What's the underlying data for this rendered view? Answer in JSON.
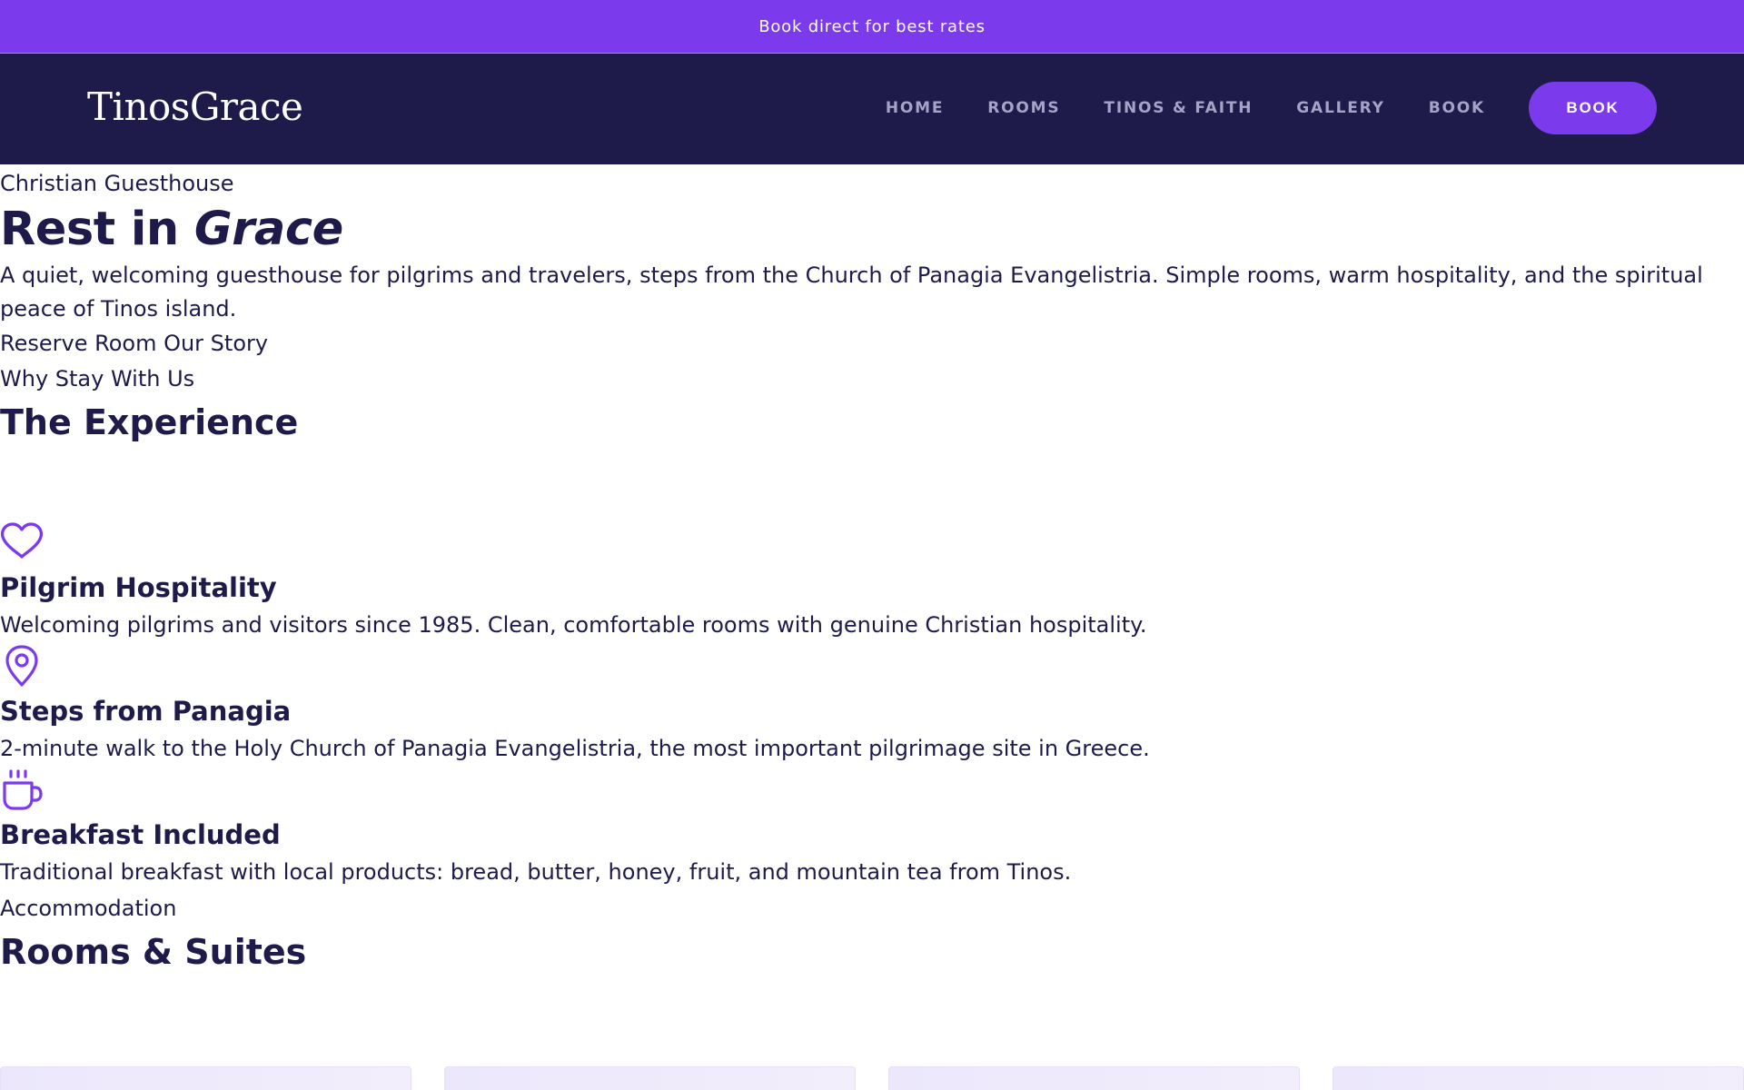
{
  "announcement": {
    "text": "Book direct for best rates"
  },
  "header": {
    "logo": "TinosGrace",
    "nav": [
      {
        "label": "HOME"
      },
      {
        "label": "ROOMS"
      },
      {
        "label": "TINOS & FAITH"
      },
      {
        "label": "GALLERY"
      },
      {
        "label": "BOOK"
      }
    ],
    "cta_label": "BOOK"
  },
  "hero": {
    "eyebrow": "Christian Guesthouse",
    "title_plain": "Rest in ",
    "title_emphasis": "Grace",
    "description": "A quiet, welcoming guesthouse for pilgrims and travelers, steps from the Church of Panagia Evangelistria. Simple rooms, warm hospitality, and the spiritual peace of Tinos island.",
    "actions": "Reserve Room Our Story"
  },
  "experience": {
    "eyebrow": "Why Stay With Us",
    "title": "The Experience",
    "features": [
      {
        "icon": "heart-icon",
        "title": "Pilgrim Hospitality",
        "description": "Welcoming pilgrims and visitors since 1985. Clean, comfortable rooms with genuine Christian hospitality."
      },
      {
        "icon": "map-pin-icon",
        "title": "Steps from Panagia",
        "description": "2-minute walk to the Holy Church of Panagia Evangelistria, the most important pilgrimage site in Greece."
      },
      {
        "icon": "coffee-cup-icon",
        "title": "Breakfast Included",
        "description": "Traditional breakfast with local products: bread, butter, honey, fruit, and mountain tea from Tinos."
      }
    ]
  },
  "rooms": {
    "eyebrow": "Accommodation",
    "title": "Rooms & Suites"
  },
  "colors": {
    "accent": "#7c3aed",
    "navy": "#1e1b4b",
    "nav_text": "#a5a3c7",
    "card_tint": "#ece7fb"
  }
}
